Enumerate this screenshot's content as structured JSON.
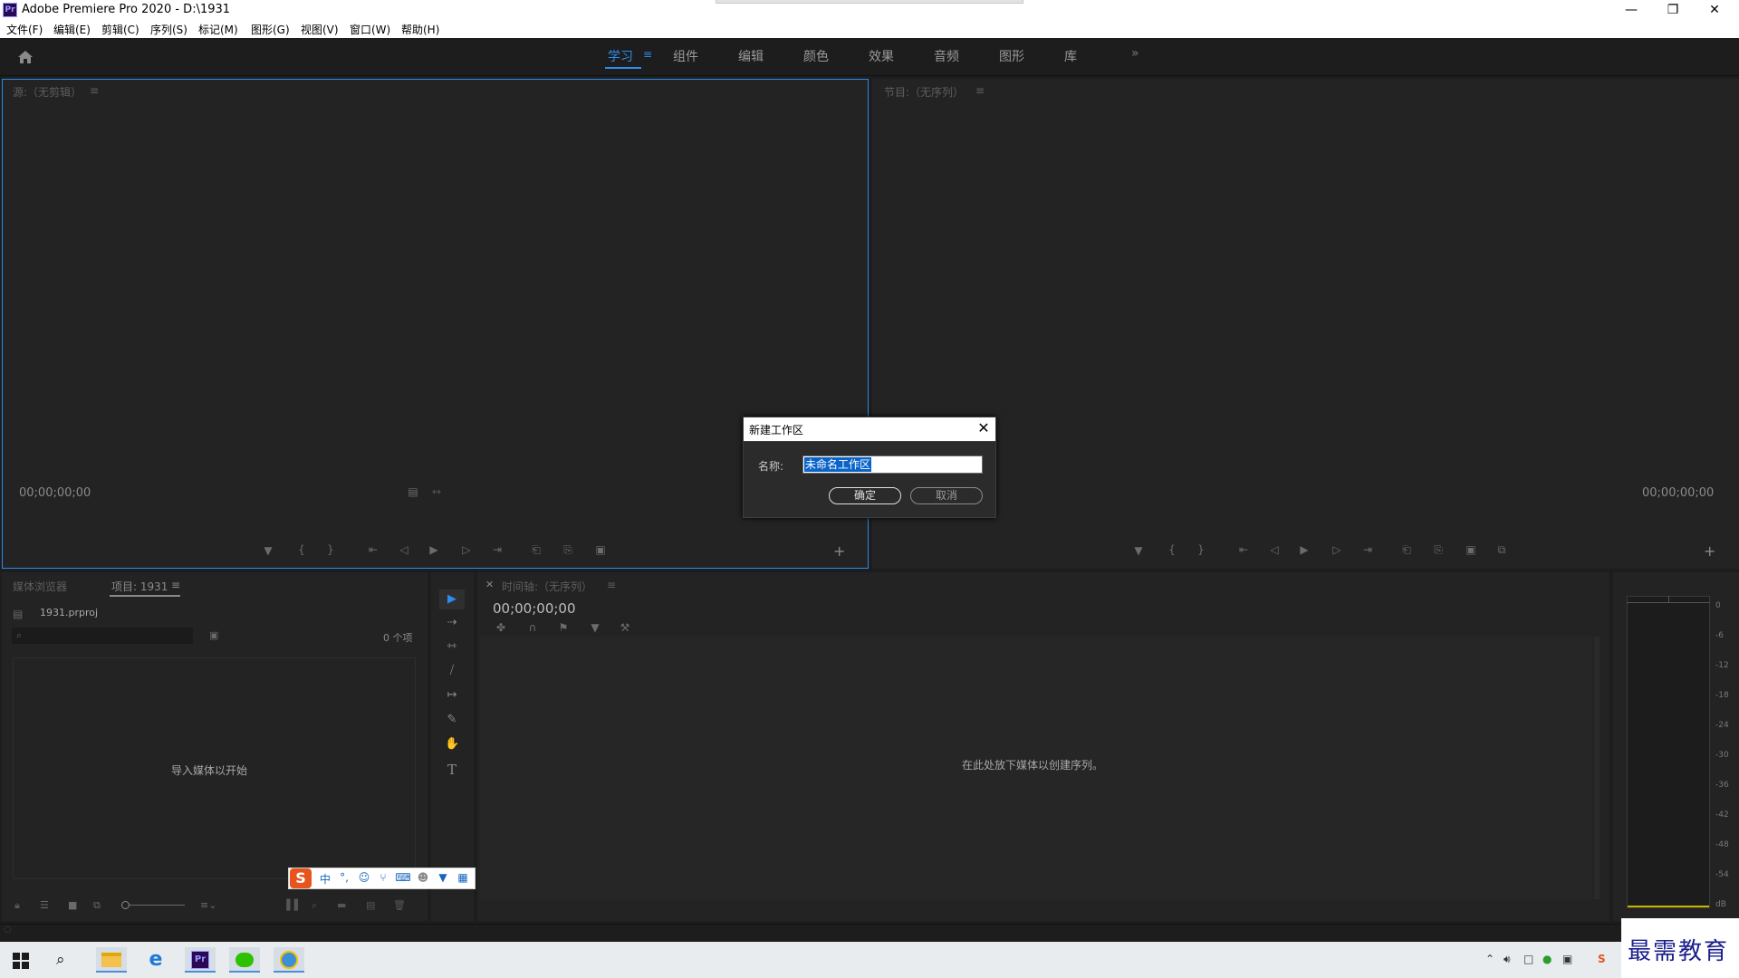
{
  "window": {
    "title": "Adobe Premiere Pro 2020 - D:\\1931",
    "app_icon": "Pr",
    "controls": [
      "minimize-icon",
      "restore-icon",
      "close-icon"
    ]
  },
  "menu": {
    "items": [
      "文件(F)",
      "编辑(E)",
      "剪辑(C)",
      "序列(S)",
      "标记(M)",
      "图形(G)",
      "视图(V)",
      "窗口(W)",
      "帮助(H)"
    ]
  },
  "workspaces": {
    "tabs": [
      "学习",
      "组件",
      "编辑",
      "颜色",
      "效果",
      "音频",
      "图形",
      "库"
    ],
    "active": "学习",
    "more": "»"
  },
  "source_monitor": {
    "title": "源:（无剪辑）",
    "timecode": "00;00;00;00"
  },
  "program_monitor": {
    "title": "节目:（无序列）",
    "timecode": "00;00;00;00"
  },
  "project_panel": {
    "tab_media_browser": "媒体浏览器",
    "tab_project": "项目: 1931",
    "file_name": "1931.prproj",
    "item_count": "0 个项",
    "empty_message": "导入媒体以开始"
  },
  "timeline_panel": {
    "title": "时间轴:（无序列）",
    "timecode": "00;00;00;00",
    "empty_message": "在此处放下媒体以创建序列。"
  },
  "audio_meter": {
    "labels": [
      "0",
      "-6",
      "-12",
      "-18",
      "-24",
      "-30",
      "-36",
      "-42",
      "-48",
      "-54",
      "dB"
    ]
  },
  "dialog": {
    "title": "新建工作区",
    "name_label": "名称:",
    "name_value": "未命名工作区",
    "ok_label": "确定",
    "cancel_label": "取消"
  },
  "ime_toolbar": {
    "logo": "S",
    "mode": "中",
    "punct": "°,"
  },
  "watermark": "最需教育",
  "colors": {
    "accent": "#2d8ceb",
    "panel_bg": "#232323",
    "app_bg": "#1d1d1d"
  }
}
